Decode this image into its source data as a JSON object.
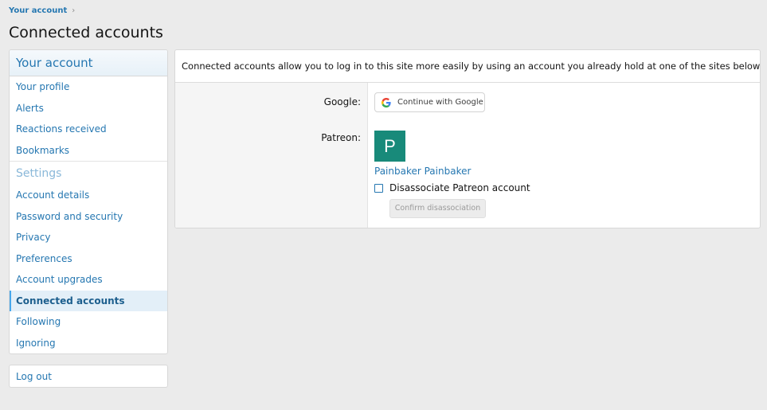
{
  "breadcrumb": {
    "label": "Your account",
    "chevron": "›"
  },
  "page_title": "Connected accounts",
  "sidebar": {
    "header": "Your account",
    "items_top": [
      {
        "label": "Your profile"
      },
      {
        "label": "Alerts"
      },
      {
        "label": "Reactions received"
      },
      {
        "label": "Bookmarks"
      }
    ],
    "section_title": "Settings",
    "items_settings": [
      {
        "label": "Account details"
      },
      {
        "label": "Password and security"
      },
      {
        "label": "Privacy"
      },
      {
        "label": "Preferences"
      },
      {
        "label": "Account upgrades"
      },
      {
        "label": "Connected accounts",
        "active": true
      },
      {
        "label": "Following"
      },
      {
        "label": "Ignoring"
      }
    ],
    "logout": "Log out"
  },
  "main": {
    "intro": "Connected accounts allow you to log in to this site more easily by using an account you already hold at one of the sites below.",
    "google": {
      "label": "Google:",
      "button": "Continue with Google",
      "icon": "google-g-icon"
    },
    "patreon": {
      "label": "Patreon:",
      "avatar_letter": "P",
      "account_name": "Painbaker Painbaker",
      "disassociate_label": "Disassociate Patreon account",
      "confirm_button": "Confirm disassociation"
    }
  },
  "colors": {
    "link": "#2577b1",
    "avatar_bg": "#188a7a",
    "background": "#ebebeb",
    "active_item_bg": "#e3eff8"
  }
}
